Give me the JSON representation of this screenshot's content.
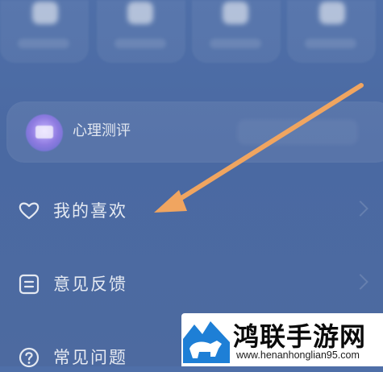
{
  "menu": {
    "psych_test": {
      "label": "心理测评"
    },
    "items": [
      {
        "label": "我的喜欢",
        "icon": "heart-icon"
      },
      {
        "label": "意见反馈",
        "icon": "feedback-icon"
      },
      {
        "label": "常见问题",
        "icon": "question-icon"
      }
    ]
  },
  "annotation": {
    "arrow_color": "#f0a560",
    "points_to": "我的喜欢"
  },
  "watermark": {
    "brand": "鸿联手游网",
    "url": "www.henanhonglian95.com"
  },
  "colors": {
    "background": "#4c6ba4",
    "text": "#ffffff",
    "arrow": "#f0a560"
  }
}
